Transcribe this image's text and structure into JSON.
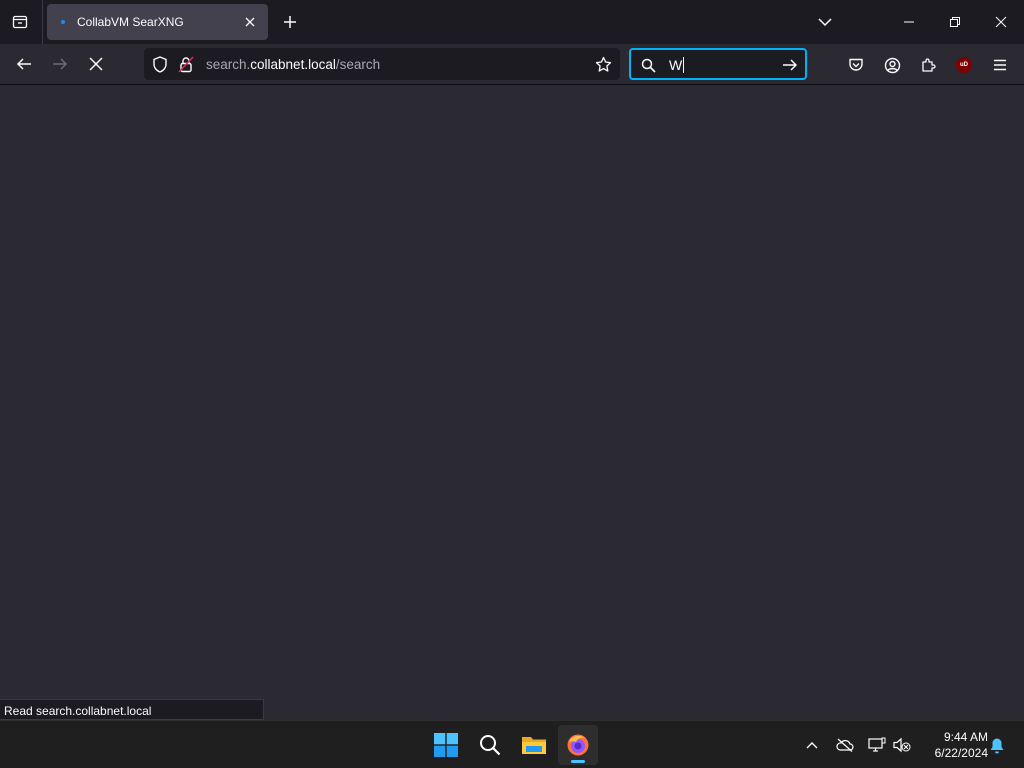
{
  "tab": {
    "title": "CollabVM SearXNG"
  },
  "urlbar": {
    "host": "search.collabnet.local",
    "host_prefix": "search.",
    "host_domain": "collabnet.local",
    "path": "/search"
  },
  "searchbar": {
    "value": "W"
  },
  "status": {
    "text": "Read search.collabnet.local"
  },
  "clock": {
    "time": "9:44 AM",
    "date": "6/22/2024"
  },
  "colors": {
    "accent": "#00b3f4",
    "page_bg": "#2b2a33",
    "toolbar_bg": "#1c1b22",
    "taskbar_bg": "#1f1f1f",
    "ublock": "#800000"
  },
  "icons": {
    "ublock_label": "uD"
  }
}
